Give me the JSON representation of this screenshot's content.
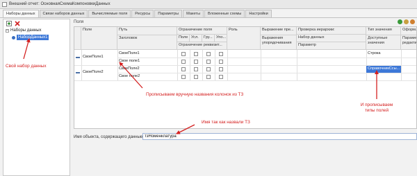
{
  "window": {
    "title": "Внешний отчет: ОсновнаяСхемаКомпоновкиДанных"
  },
  "tabs": [
    {
      "label": "Наборы данных",
      "active": true
    },
    {
      "label": "Связи наборов данных"
    },
    {
      "label": "Вычисляемые поля"
    },
    {
      "label": "Ресурсы"
    },
    {
      "label": "Параметры"
    },
    {
      "label": "Макеты"
    },
    {
      "label": "Вложенные схемы"
    },
    {
      "label": "Настройки"
    }
  ],
  "tree": {
    "root": "Наборы данных",
    "child": "НаборДанных1"
  },
  "fields_panel": {
    "label": "Поля"
  },
  "columns": {
    "field": "Поле",
    "path": "Путь",
    "title": "Заголовок",
    "restriction": "Ограничение поля",
    "restriction_attrs": "Ограничение реквизит...",
    "field_sub": "Поле",
    "cond": "Усл.",
    "group": "Гру...",
    "order": "Упо...",
    "role": "Роль",
    "expr_view": "Выражение пре...",
    "expr_order": "Выражения упорядочивания",
    "hierarchy_check": "Проверка иерархии:",
    "dataset": "Набор данных",
    "param": "Параметр",
    "value_type": "Тип значения",
    "available_values": "Доступные значения",
    "design": "Оформ...",
    "edit": "Параметр редакти..."
  },
  "rows": [
    {
      "field": "СвоеПоле1",
      "path": "СвоеПоле1",
      "title": "Свое поле1",
      "type": "Строка"
    },
    {
      "field": "СвоеПоле2",
      "path": "СвоеПоле2",
      "title": "Свое поле2",
      "type": "СправочникСсы..."
    }
  ],
  "annotations": {
    "own_dataset": "Свой набор данных",
    "column_names": "Прописываем вручную названия колонок из ТЗ",
    "field_types_1": "И прописываем",
    "field_types_2": "типы полей",
    "name_as_vt": "Имя так как назвали ТЗ"
  },
  "object_name": {
    "label": "Имя объекта, содержащего данные:",
    "value": "тзНоменклатура"
  },
  "colors": {
    "annotation": "#d42020",
    "selection": "#3d78d8"
  }
}
